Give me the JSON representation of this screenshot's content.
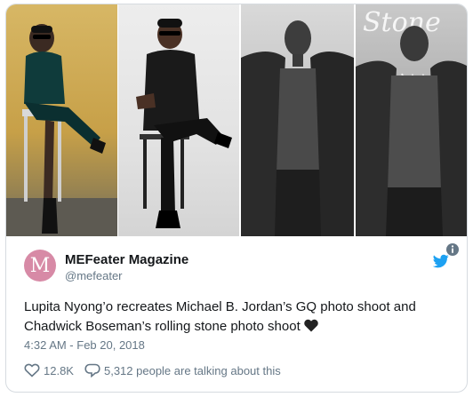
{
  "account": {
    "avatar_letter": "M",
    "display_name": "MEFeater Magazine",
    "handle": "@mefeater"
  },
  "tweet": {
    "text": "Lupita Nyong’o recreates Michael B. Jordan’s GQ photo shoot  and Chadwick Boseman’s rolling stone photo shoot",
    "emoji": "black-heart",
    "timestamp": "4:32 AM - Feb 20, 2018"
  },
  "engagement": {
    "likes": "12.8K",
    "conversation": "5,312 people are talking about this"
  },
  "colors": {
    "twitter_blue": "#1da1f2",
    "avatar_bg": "#d78aa6",
    "secondary_text": "#657786"
  },
  "photos": [
    {
      "icon": "photo-lupita-gq-recreation"
    },
    {
      "icon": "photo-michael-b-jordan-gq"
    },
    {
      "icon": "photo-lupita-rolling-stone-recreation"
    },
    {
      "icon": "photo-chadwick-boseman-rolling-stone"
    }
  ]
}
